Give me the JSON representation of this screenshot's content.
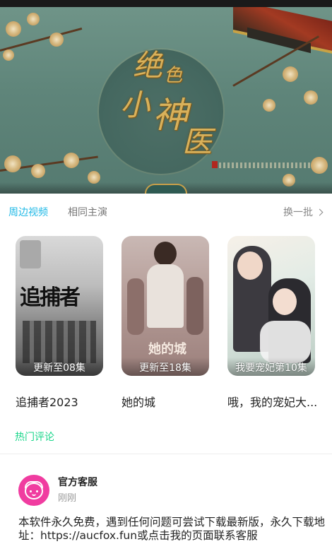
{
  "hero": {
    "title_chars": [
      "绝",
      "色",
      "小",
      "神",
      "医"
    ]
  },
  "tabs": {
    "active": "周边视频",
    "inactive": "相同主演",
    "refresh": "换一批"
  },
  "cards": [
    {
      "title": "追捕者2023",
      "episode": "更新至08集",
      "poster_text": "追捕者"
    },
    {
      "title": "她的城",
      "episode": "更新至18集",
      "poster_text": "她的城"
    },
    {
      "title": "哦，我的宠妃大...",
      "episode": "我要宠妃第10集",
      "poster_text": ""
    }
  ],
  "section": {
    "hot_comments": "热门评论"
  },
  "comment": {
    "author": "官方客服",
    "time": "刚刚",
    "text": "本软件永久免费，遇到任何问题可尝试下载最新版，永久下载地址：https://aucfox.fun或点击我的页面联系客服"
  },
  "colors": {
    "accent_blue": "#1eb8e6",
    "accent_green": "#19d68a",
    "avatar_pink": "#f03ca0"
  }
}
